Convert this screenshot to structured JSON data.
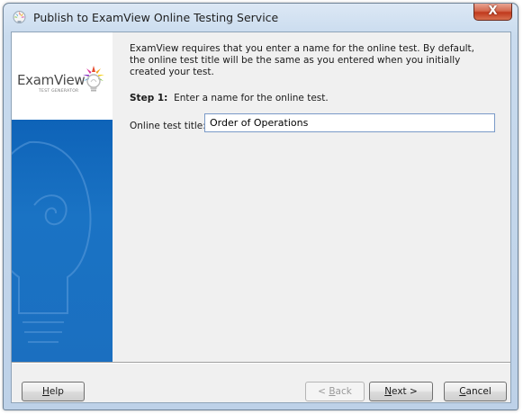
{
  "window": {
    "title": "Publish to ExamView Online Testing Service",
    "close_glyph": "X"
  },
  "sidebar": {
    "logo_text": "ExamView",
    "logo_sub": "TEST GENERATOR"
  },
  "main": {
    "description": "ExamView requires that you enter a name for the online test.  By default, the online test title will be the same as you entered when you initially created your test.",
    "step_label": "Step 1:",
    "step_text": "Enter a name for the online test.",
    "field_label": "Online test title:",
    "field_value": "Order of Operations"
  },
  "buttons": {
    "help": {
      "accel": "H",
      "rest": "elp"
    },
    "back": {
      "prefix": "< ",
      "accel": "B",
      "rest": "ack"
    },
    "next": {
      "accel": "N",
      "rest": "ext >"
    },
    "cancel": {
      "accel": "C",
      "rest": "ancel"
    }
  },
  "colors": {
    "sidebar_blue": "#1a73c4",
    "close_red": "#c8432a"
  }
}
